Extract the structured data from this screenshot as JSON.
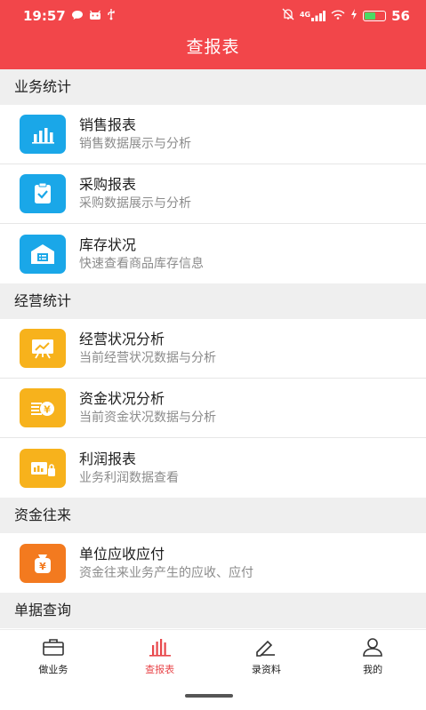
{
  "status_bar": {
    "time": "19:57",
    "network": "4G",
    "battery": "56",
    "battery_level": 0.56,
    "left_icons": [
      "chat-bubble-icon",
      "android-icon",
      "usb-icon"
    ],
    "right_icons": [
      "mute-icon",
      "signal-icon",
      "wifi-hd-icon",
      "charging-icon",
      "battery-icon"
    ]
  },
  "header": {
    "title": "查报表",
    "background_color": "#f2464a"
  },
  "sections": [
    {
      "title": "业务统计",
      "items": [
        {
          "title": "销售报表",
          "subtitle": "销售数据展示与分析",
          "icon": "bar-chart-icon",
          "color": "#1aa7e8"
        },
        {
          "title": "采购报表",
          "subtitle": "采购数据展示与分析",
          "icon": "clipboard-check-icon",
          "color": "#1aa7e8"
        },
        {
          "title": "库存状况",
          "subtitle": "快速查看商品库存信息",
          "icon": "warehouse-icon",
          "color": "#1aa7e8"
        }
      ]
    },
    {
      "title": "经营统计",
      "items": [
        {
          "title": "经营状况分析",
          "subtitle": "当前经营状况数据与分析",
          "icon": "trend-board-icon",
          "color": "#f7b21c"
        },
        {
          "title": "资金状况分析",
          "subtitle": "当前资金状况数据与分析",
          "icon": "money-coin-icon",
          "color": "#f7b21c"
        },
        {
          "title": "利润报表",
          "subtitle": "业务利润数据查看",
          "icon": "profit-report-icon",
          "color": "#f7b21c"
        }
      ]
    },
    {
      "title": "资金往来",
      "items": [
        {
          "title": "单位应收应付",
          "subtitle": "资金往来业务产生的应收、应付",
          "icon": "money-bag-icon",
          "color": "#f37a1f"
        }
      ]
    },
    {
      "title": "单据查询",
      "items": []
    }
  ],
  "tabbar": {
    "active_color": "#e8474b",
    "tabs": [
      {
        "label": "做业务",
        "icon": "briefcase-icon",
        "active": false
      },
      {
        "label": "查报表",
        "icon": "bar-chart-icon",
        "active": true
      },
      {
        "label": "录资料",
        "icon": "edit-pen-icon",
        "active": false
      },
      {
        "label": "我的",
        "icon": "user-icon",
        "active": false
      }
    ]
  }
}
